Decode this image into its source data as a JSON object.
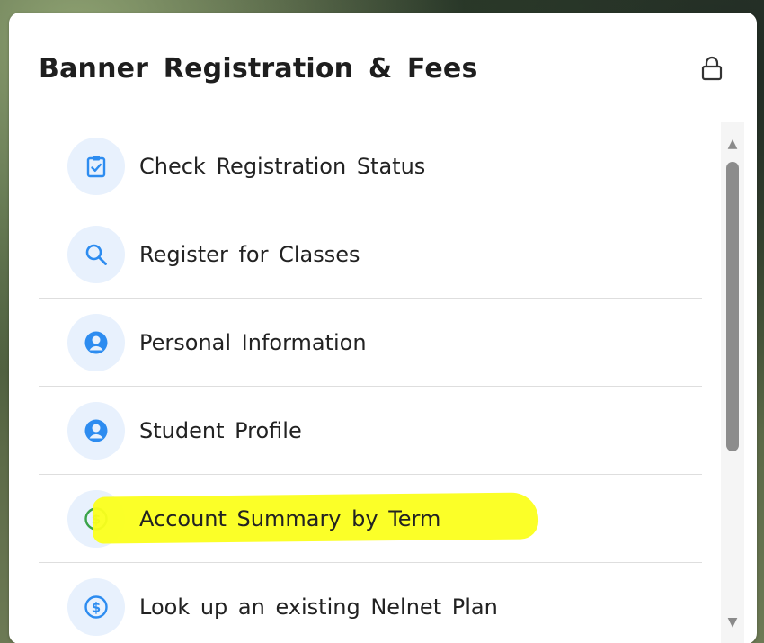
{
  "card": {
    "title": "Banner Registration & Fees",
    "lock_icon": "lock-icon"
  },
  "items": [
    {
      "label": "Check Registration Status",
      "icon": "clipboard-check-icon"
    },
    {
      "label": "Register for Classes",
      "icon": "search-icon"
    },
    {
      "label": "Personal Information",
      "icon": "user-circle-icon"
    },
    {
      "label": "Student Profile",
      "icon": "user-circle-icon"
    },
    {
      "label": "Account Summary by Term",
      "icon": "dollar-circle-icon",
      "highlighted": true
    },
    {
      "label": "Look up an existing Nelnet Plan",
      "icon": "dollar-circle-icon"
    }
  ],
  "colors": {
    "icon_blue": "#2d8cf0",
    "icon_bg": "#e8f1fd",
    "highlight": "#fbff1c",
    "highlight_icon_green": "#3aa34a"
  },
  "scroll": {
    "position": 0.0,
    "visible_fraction": 0.6
  }
}
